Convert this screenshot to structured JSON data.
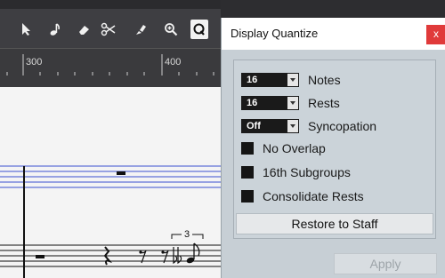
{
  "toolbar": {
    "tools": [
      "select-tool",
      "note-tool",
      "eraser-tool",
      "scissors-tool",
      "glue-tool",
      "zoom-tool",
      "quantize-tool"
    ]
  },
  "ruler": {
    "marks": [
      "300",
      "400"
    ]
  },
  "score": {
    "tuplet_label": "3"
  },
  "dialog": {
    "title": "Display Quantize",
    "close_label": "x",
    "notes": {
      "value": "16",
      "label": "Notes"
    },
    "rests": {
      "value": "16",
      "label": "Rests"
    },
    "syncopation": {
      "value": "Off",
      "label": "Syncopation"
    },
    "no_overlap_label": "No Overlap",
    "subgroups_label": "16th Subgroups",
    "consolidate_label": "Consolidate Rests",
    "restore_label": "Restore to Staff",
    "apply_label": "Apply"
  }
}
